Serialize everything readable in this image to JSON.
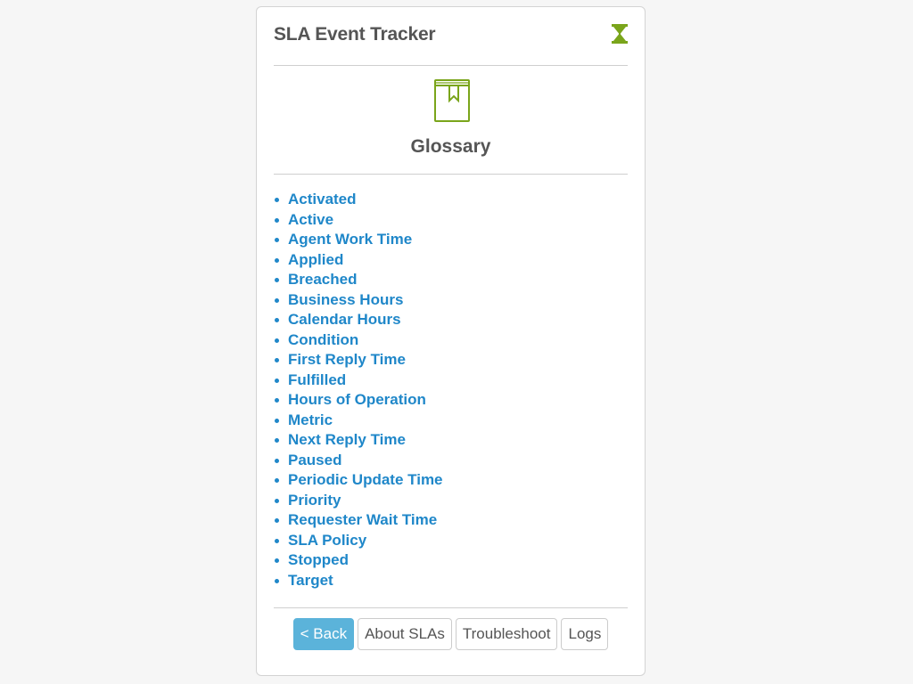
{
  "header": {
    "title": "SLA Event Tracker",
    "icon": "hourglass-icon",
    "accent_color": "#7aa51b"
  },
  "hero": {
    "icon": "book-icon",
    "title": "Glossary"
  },
  "glossary": {
    "link_color": "#1f87c9",
    "items": [
      "Activated",
      "Active",
      "Agent Work Time",
      "Applied",
      "Breached",
      "Business Hours",
      "Calendar Hours",
      "Condition",
      "First Reply Time",
      "Fulfilled",
      "Hours of Operation",
      "Metric",
      "Next Reply Time",
      "Paused",
      "Periodic Update Time",
      "Priority",
      "Requester Wait Time",
      "SLA Policy",
      "Stopped",
      "Target"
    ]
  },
  "footer": {
    "back_label": "< Back",
    "about_label": "About SLAs",
    "troubleshoot_label": "Troubleshoot",
    "logs_label": "Logs",
    "primary_color": "#5bb3da"
  }
}
